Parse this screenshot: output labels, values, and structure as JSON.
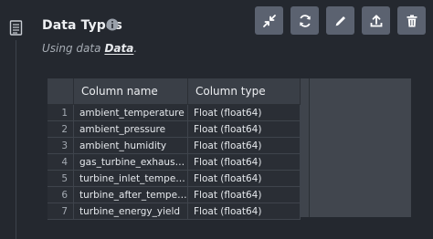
{
  "header": {
    "title": "Data Types",
    "subtitle_prefix": "Using data",
    "data_link": "Data",
    "subtitle_suffix": "."
  },
  "icons": {
    "document": "document-icon",
    "info": "info-icon",
    "collapse": "collapse-arrows-icon",
    "refresh": "refresh-icon",
    "edit": "pencil-icon",
    "export": "upload-icon",
    "delete": "trash-icon"
  },
  "colors": {
    "background": "#24282f",
    "toolbar_button": "#5b6270",
    "grid_header": "#3a3f47",
    "grid_cell": "#2a2e35"
  },
  "table": {
    "headers": [
      "Column name",
      "Column type"
    ],
    "rows": [
      {
        "num": "1",
        "name": "ambient_temperature",
        "type": "Float (float64)"
      },
      {
        "num": "2",
        "name": "ambient_pressure",
        "type": "Float (float64)"
      },
      {
        "num": "3",
        "name": "ambient_humidity",
        "type": "Float (float64)"
      },
      {
        "num": "4",
        "name": "gas_turbine_exhaust_...",
        "type": "Float (float64)"
      },
      {
        "num": "5",
        "name": "turbine_inlet_temper...",
        "type": "Float (float64)"
      },
      {
        "num": "6",
        "name": "turbine_after_temper...",
        "type": "Float (float64)"
      },
      {
        "num": "7",
        "name": "turbine_energy_yield",
        "type": "Float (float64)"
      }
    ]
  }
}
